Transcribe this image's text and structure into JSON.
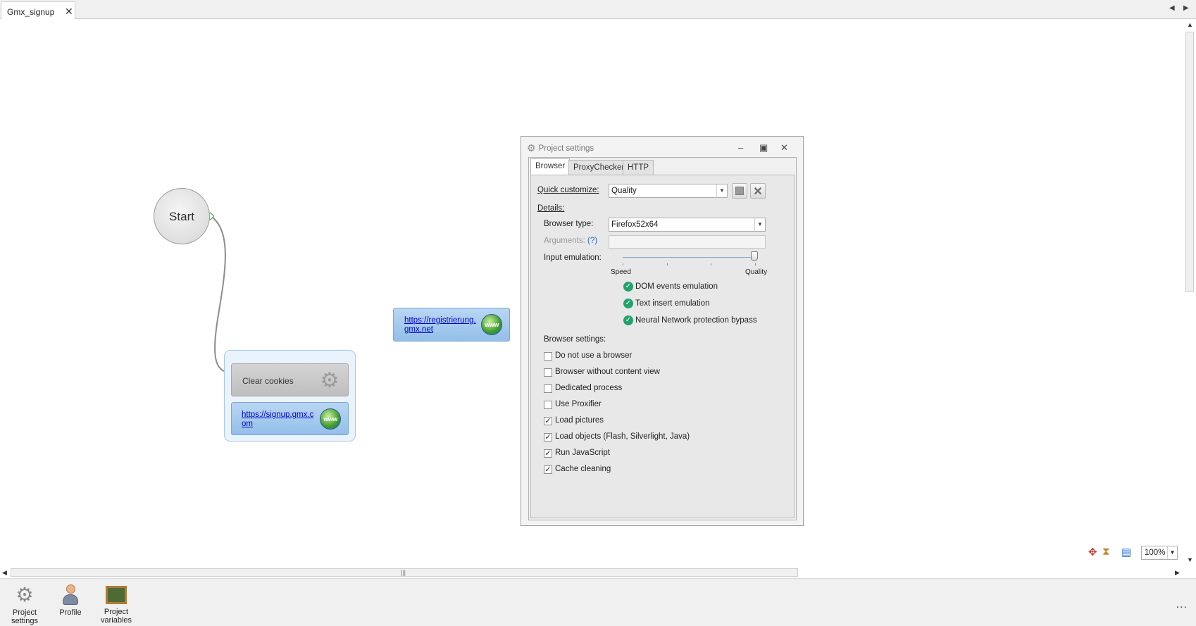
{
  "tab": {
    "title": "Gmx_signup",
    "close": "✕"
  },
  "canvas": {
    "start_label": "Start",
    "clear_cookies_label": "Clear cookies",
    "url_signup": "https://signup.gmx.com",
    "url_registrierung": "https://registrierung.gmx.net",
    "www_label": "www"
  },
  "project_settings": {
    "title": "Project settings",
    "tabs": [
      "Browser",
      "ProxyChecker",
      "HTTP"
    ],
    "quick_customize_label": "Quick customize:",
    "quick_customize_value": "Quality",
    "details_label": "Details:",
    "browser_type_label": "Browser type:",
    "browser_type_value": "Firefox52x64",
    "arguments_label": "Arguments:",
    "arguments_help": "(?)",
    "input_emulation_label": "Input emulation:",
    "slider_min_label": "Speed",
    "slider_max_label": "Quality",
    "slider_value": 1.0,
    "emulation_options": [
      {
        "label": "DOM events emulation",
        "enabled": true
      },
      {
        "label": "Text insert emulation",
        "enabled": true
      },
      {
        "label": "Neural Network protection bypass",
        "enabled": true
      }
    ],
    "browser_settings_label": "Browser settings:",
    "browser_settings": [
      {
        "label": "Do not use a browser",
        "checked": false
      },
      {
        "label": "Browser without content view",
        "checked": false
      },
      {
        "label": "Dedicated process",
        "checked": false
      },
      {
        "label": "Use Proxifier",
        "checked": false
      },
      {
        "label": "Load pictures",
        "checked": true
      },
      {
        "label": "Load objects (Flash, Silverlight, Java)",
        "checked": true
      },
      {
        "label": "Run JavaScript",
        "checked": true
      },
      {
        "label": "Cache cleaning",
        "checked": true
      }
    ]
  },
  "zoom": {
    "value": "100%"
  },
  "bottombar": {
    "items": [
      {
        "label": "Project settings"
      },
      {
        "label": "Profile"
      },
      {
        "label": "Project variables"
      }
    ],
    "more": "..."
  },
  "colors": {
    "accent": "#2a6fd0",
    "check_green": "#23a36b",
    "node_blue": "#93bfe9"
  }
}
